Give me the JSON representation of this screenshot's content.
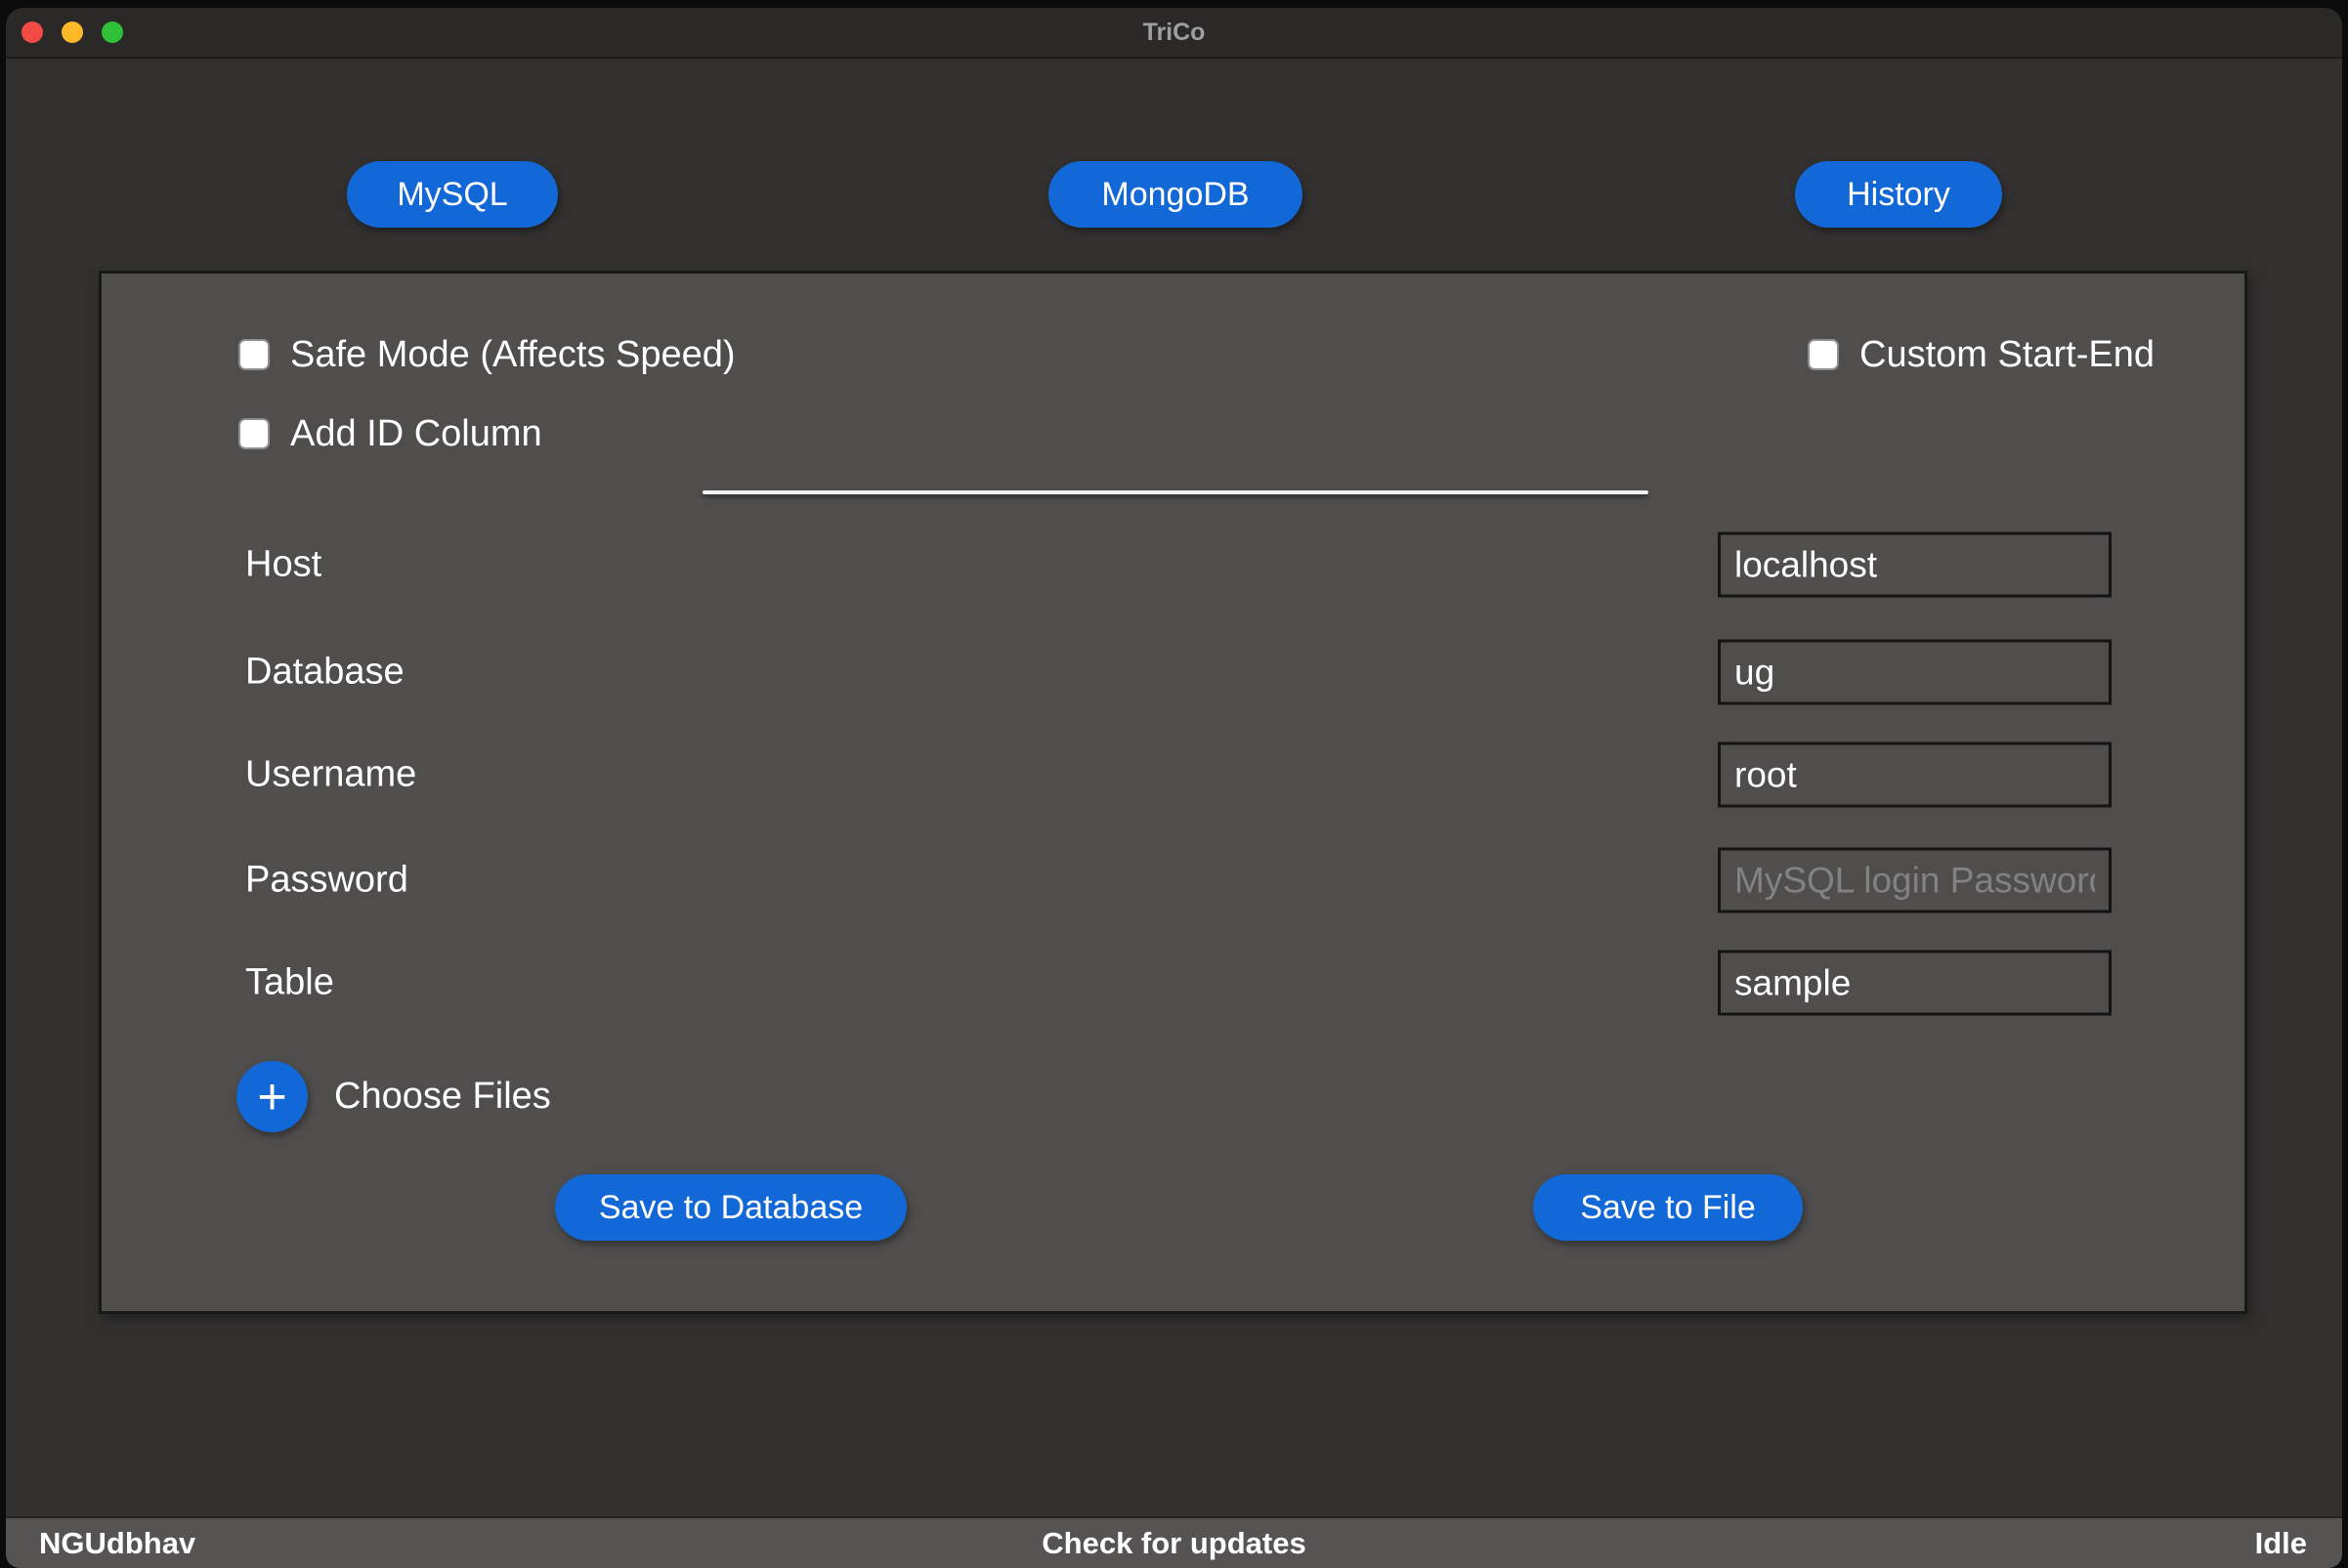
{
  "window": {
    "title": "TriCo"
  },
  "nav_buttons": {
    "mysql": "MySQL",
    "mongodb": "MongoDB",
    "history": "History"
  },
  "checkboxes": {
    "safe_mode": {
      "label": "Safe Mode (Affects Speed)",
      "checked": false
    },
    "add_id_column": {
      "label": "Add ID Column",
      "checked": false
    },
    "custom_start_end": {
      "label": "Custom Start-End",
      "checked": false
    }
  },
  "form": {
    "fields": [
      {
        "label": "Host",
        "value": "localhost",
        "placeholder": ""
      },
      {
        "label": "Database",
        "value": "ug",
        "placeholder": ""
      },
      {
        "label": "Username",
        "value": "root",
        "placeholder": ""
      },
      {
        "label": "Password",
        "value": "",
        "placeholder": "MySQL login Password"
      },
      {
        "label": "Table",
        "value": "sample",
        "placeholder": ""
      }
    ]
  },
  "file_picker": {
    "plus_icon": "+",
    "label": "Choose Files"
  },
  "actions": {
    "save_database": "Save to Database",
    "save_file": "Save to File"
  },
  "status_bar": {
    "left": "NGUdbhav",
    "center": "Check for updates",
    "right": "Idle"
  },
  "colors": {
    "accent_blue": "#1268d6",
    "panel_bg": "#4f4e4d",
    "window_bg": "#323130",
    "titlebar_bg": "#2a2928",
    "statusbar_bg": "#555453"
  }
}
